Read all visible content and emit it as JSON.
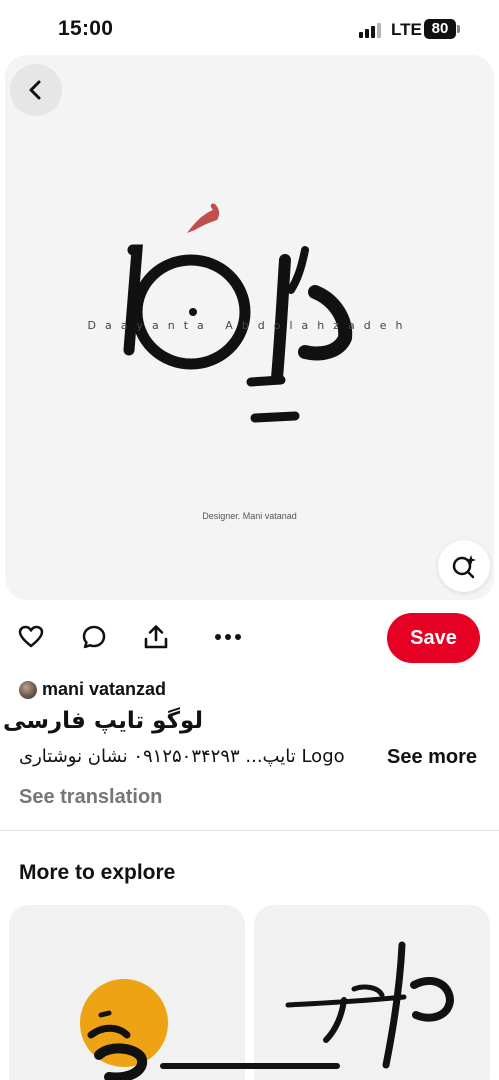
{
  "status_bar": {
    "time": "15:00",
    "network": "LTE",
    "battery": "80"
  },
  "pin": {
    "logo_caption": "Daayanta Abdolahzadeh",
    "designer_credit": "Designer. Mani vatanad",
    "creator_name": "mani vatanzad",
    "title": "لوگو تایپ فارسی",
    "description": "Logo تایپ... ۰۹۱۲۵۰۳۴۲۹۳ نشان نوشتاری",
    "see_more_label": "See more",
    "see_translation_label": "See translation",
    "save_label": "Save"
  },
  "actions": [
    "heart-icon",
    "comment-icon",
    "share-icon",
    "more-icon"
  ],
  "explore": {
    "heading": "More to explore"
  },
  "colors": {
    "save_red": "#e60023",
    "logo_accent": "#c0504d",
    "thumb_accent": "#eda313"
  }
}
